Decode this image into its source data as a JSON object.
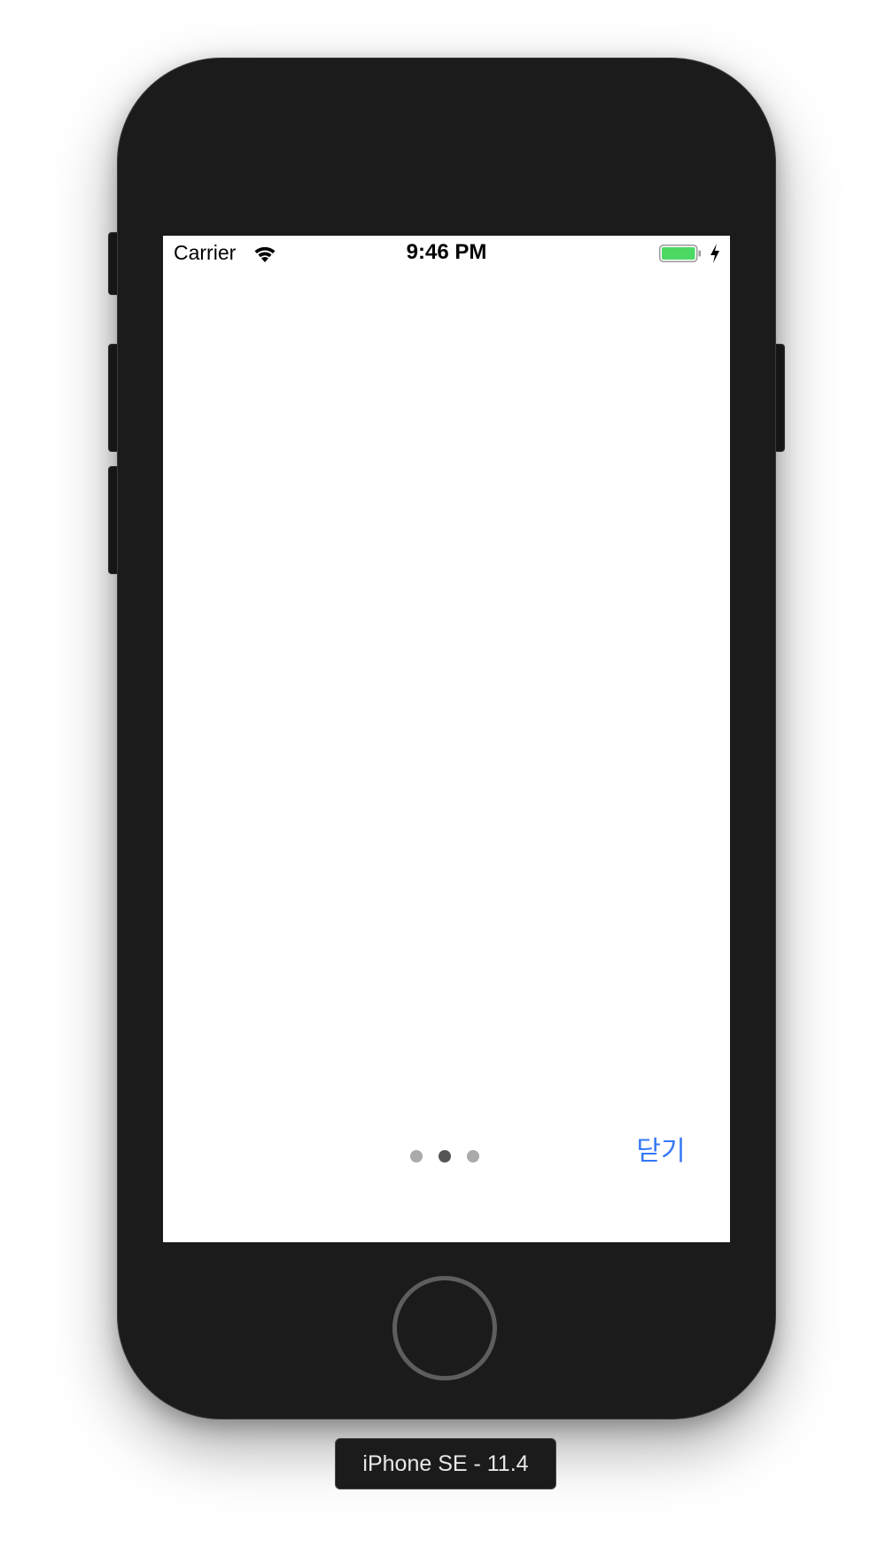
{
  "status_bar": {
    "carrier": "Carrier",
    "time": "9:46 PM",
    "icons": [
      "wifi-icon",
      "battery-icon",
      "charging-bolt-icon"
    ],
    "battery_color": "#4cd964"
  },
  "pager": {
    "page_count": 3,
    "current_page_index": 1,
    "active_color": "#555555",
    "inactive_color": "#aaaaaa"
  },
  "close_button": {
    "label": "닫기",
    "color": "#3478f6"
  },
  "simulator": {
    "device_label": "iPhone SE - 11.4"
  }
}
